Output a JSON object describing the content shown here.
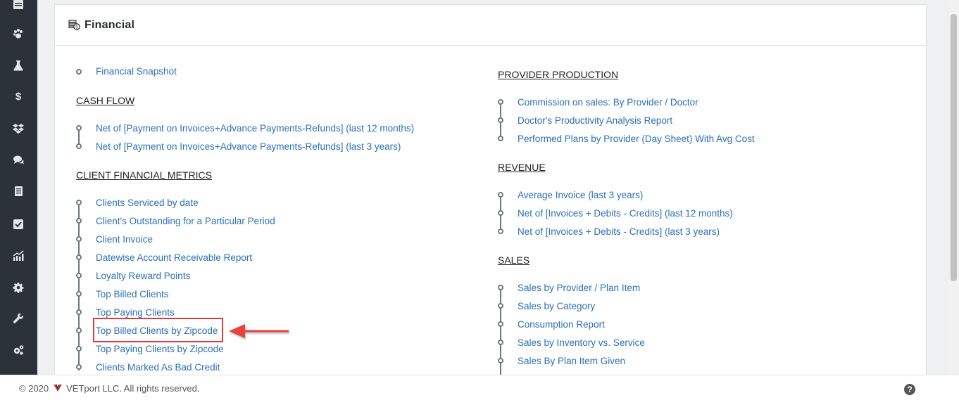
{
  "panel": {
    "title": "Financial"
  },
  "left": {
    "snapshot": "Financial Snapshot",
    "cash_flow": {
      "title": "CASH FLOW",
      "items": [
        "Net of [Payment on Invoices+Advance Payments-Refunds] (last 12 months)",
        "Net of [Payment on Invoices+Advance Payments-Refunds] (last 3 years)"
      ]
    },
    "client_metrics": {
      "title": "CLIENT FINANCIAL METRICS",
      "items": [
        "Clients Serviced by date",
        "Client's Outstanding for a Particular Period",
        "Client Invoice",
        "Datewise Account Receivable Report",
        "Loyalty Reward Points",
        "Top Billed Clients",
        "Top Paying Clients",
        "Top Billed Clients by Zipcode",
        "Top Paying Clients by Zipcode",
        "Clients Marked As Bad Credit"
      ]
    }
  },
  "right": {
    "provider": {
      "title": "PROVIDER PRODUCTION",
      "items": [
        "Commission on sales: By Provider / Doctor",
        "Doctor's Productivity Analysis Report",
        "Performed Plans by Provider (Day Sheet) With Avg Cost"
      ]
    },
    "revenue": {
      "title": "REVENUE",
      "items": [
        "Average Invoice (last 3 years)",
        "Net of [Invoices + Debits - Credits] (last 12 months)",
        "Net of [Invoices + Debits - Credits] (last 3 years)"
      ]
    },
    "sales": {
      "title": "SALES",
      "items": [
        "Sales by Provider / Plan Item",
        "Sales by Category",
        "Consumption Report",
        "Sales by Inventory vs. Service",
        "Sales By Plan Item Given"
      ]
    }
  },
  "footer": {
    "copyright": "© 2020",
    "company": "VETport LLC. All rights reserved.",
    "help": "?"
  },
  "colors": {
    "link": "#2c70b5",
    "highlight": "#e03a3a",
    "sidebar": "#2b3239"
  },
  "sidebar_icons": [
    "calendar-icon",
    "paw-icon",
    "flask-icon",
    "dollar-icon",
    "dropbox-icon",
    "comments-icon",
    "list-icon",
    "check-square-icon",
    "chart-icon",
    "gear-icon",
    "wrench-icon",
    "cogs-icon"
  ]
}
